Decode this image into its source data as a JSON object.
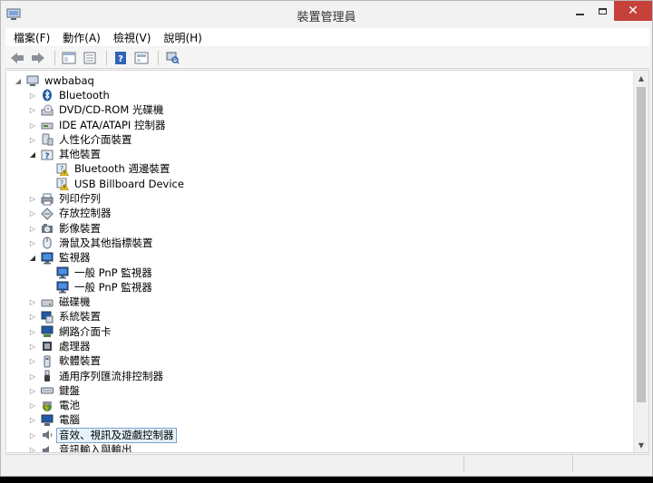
{
  "window": {
    "title": "裝置管理員",
    "close_glyph": "✕"
  },
  "menubar": {
    "items": [
      "檔案(F)",
      "動作(A)",
      "檢視(V)",
      "說明(H)"
    ]
  },
  "toolbar": {
    "icons": [
      "back-icon",
      "forward-icon",
      "properties-icon",
      "refresh-icon",
      "help-icon",
      "view-icon",
      "scan-icon"
    ]
  },
  "tree": {
    "root": "wwbabaq",
    "items": [
      {
        "label": "Bluetooth",
        "level": 1,
        "expander": "collapsed",
        "icon": "bluetooth-icon"
      },
      {
        "label": "DVD/CD-ROM 光碟機",
        "level": 1,
        "expander": "collapsed",
        "icon": "dvd-drive-icon"
      },
      {
        "label": "IDE ATA/ATAPI 控制器",
        "level": 1,
        "expander": "collapsed",
        "icon": "ide-controller-icon"
      },
      {
        "label": "人性化介面裝置",
        "level": 1,
        "expander": "collapsed",
        "icon": "hid-icon"
      },
      {
        "label": "其他裝置",
        "level": 1,
        "expander": "expanded",
        "icon": "other-devices-icon"
      },
      {
        "label": "Bluetooth 週邊裝置",
        "level": 2,
        "expander": "none",
        "icon": "warning-device-icon"
      },
      {
        "label": "USB Billboard Device",
        "level": 2,
        "expander": "none",
        "icon": "warning-device-icon"
      },
      {
        "label": "列印佇列",
        "level": 1,
        "expander": "collapsed",
        "icon": "printer-icon"
      },
      {
        "label": "存放控制器",
        "level": 1,
        "expander": "collapsed",
        "icon": "storage-controller-icon"
      },
      {
        "label": "影像裝置",
        "level": 1,
        "expander": "collapsed",
        "icon": "camera-icon"
      },
      {
        "label": "滑鼠及其他指標裝置",
        "level": 1,
        "expander": "collapsed",
        "icon": "mouse-icon"
      },
      {
        "label": "監視器",
        "level": 1,
        "expander": "expanded",
        "icon": "monitor-icon"
      },
      {
        "label": "一般 PnP 監視器",
        "level": 2,
        "expander": "none",
        "icon": "monitor-icon"
      },
      {
        "label": "一般 PnP 監視器",
        "level": 2,
        "expander": "none",
        "icon": "monitor-icon"
      },
      {
        "label": "磁碟機",
        "level": 1,
        "expander": "collapsed",
        "icon": "disk-drive-icon"
      },
      {
        "label": "系統裝置",
        "level": 1,
        "expander": "collapsed",
        "icon": "system-device-icon"
      },
      {
        "label": "網路介面卡",
        "level": 1,
        "expander": "collapsed",
        "icon": "network-adapter-icon"
      },
      {
        "label": "處理器",
        "level": 1,
        "expander": "collapsed",
        "icon": "processor-icon"
      },
      {
        "label": "軟體裝置",
        "level": 1,
        "expander": "collapsed",
        "icon": "software-device-icon"
      },
      {
        "label": "通用序列匯流排控制器",
        "level": 1,
        "expander": "collapsed",
        "icon": "usb-icon"
      },
      {
        "label": "鍵盤",
        "level": 1,
        "expander": "collapsed",
        "icon": "keyboard-icon"
      },
      {
        "label": "電池",
        "level": 1,
        "expander": "collapsed",
        "icon": "battery-icon"
      },
      {
        "label": "電腦",
        "level": 1,
        "expander": "collapsed",
        "icon": "computer-icon"
      },
      {
        "label": "音效、視訊及遊戲控制器",
        "level": 1,
        "expander": "collapsed",
        "icon": "speaker-icon",
        "selected": true
      },
      {
        "label": "音訊輸入與輸出",
        "level": 1,
        "expander": "collapsed",
        "icon": "audio-io-icon"
      }
    ]
  },
  "colors": {
    "close_button": "#c7413b",
    "selection_bg": "#e5f3fb",
    "selection_border": "#7da2ce",
    "icon_blue": "#1e5aa8",
    "warning_yellow": "#f2c200"
  }
}
